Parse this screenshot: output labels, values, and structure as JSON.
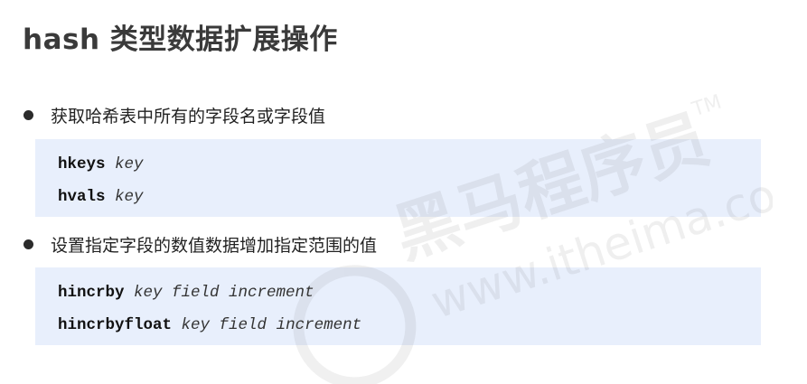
{
  "title": "hash 类型数据扩展操作",
  "sections": [
    {
      "bullet": "获取哈希表中所有的字段名或字段值",
      "code": [
        {
          "cmd": "hkeys",
          "args": "key"
        },
        {
          "cmd": "hvals",
          "args": "key"
        }
      ]
    },
    {
      "bullet": "设置指定字段的数值数据增加指定范围的值",
      "code": [
        {
          "cmd": "hincrby",
          "args": "key field increment"
        },
        {
          "cmd": "hincrbyfloat",
          "args": "key field increment"
        }
      ]
    }
  ],
  "watermark": {
    "brand": "黑马程序员",
    "tm": "TM",
    "url": "www.itheima.com"
  }
}
